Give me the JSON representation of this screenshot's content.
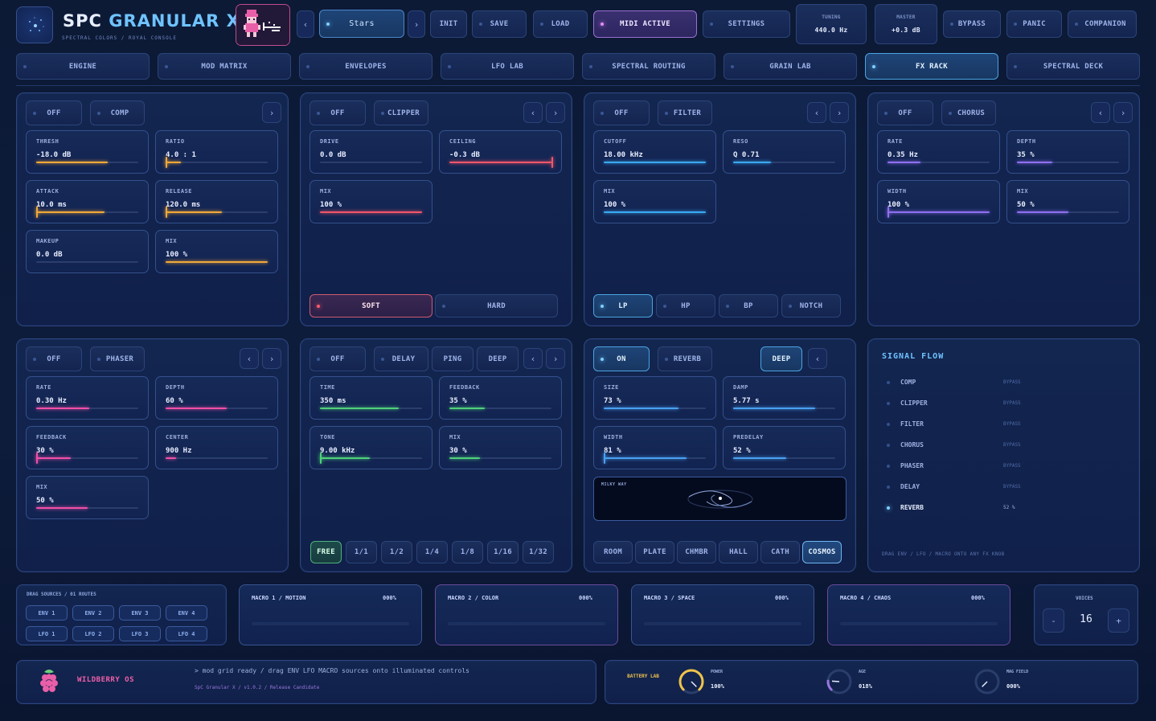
{
  "app": {
    "title_a": "SPC",
    "title_b": "GRANULAR",
    "title_c": "X",
    "subtitle": "SPECTRAL COLORS / ROYAL CONSOLE"
  },
  "topbar": {
    "preset": "Stars",
    "init": "INIT",
    "save": "SAVE",
    "load": "LOAD",
    "midi": "MIDI ACTIVE",
    "settings": "SETTINGS",
    "tuning_label": "TUNING",
    "tuning_value": "440.0 Hz",
    "master_label": "MASTER",
    "master_value": "+0.3 dB",
    "bypass": "BYPASS",
    "panic": "PANIC",
    "companion": "COMPANION"
  },
  "tabs": [
    "ENGINE",
    "MOD MATRIX",
    "ENVELOPES",
    "LFO LAB",
    "SPECTRAL ROUTING",
    "GRAIN LAB",
    "FX RACK",
    "SPECTRAL DECK"
  ],
  "active_tab": "FX RACK",
  "colors": {
    "amber": "#f0a93a",
    "red": "#f0566a",
    "blue": "#3aa9f0",
    "violet": "#8f6ff0",
    "pink": "#f04fa8",
    "green": "#4fd07a",
    "sky": "#4aa0f0"
  },
  "comp": {
    "toggle": "OFF",
    "name": "COMP",
    "params": [
      {
        "label": "THRESH",
        "value": "-18.0 dB",
        "level": 0.7
      },
      {
        "label": "RATIO",
        "value": "4.0 : 1",
        "level": 0.15
      },
      {
        "label": "ATTACK",
        "value": "10.0 ms",
        "level": 0.67
      },
      {
        "label": "RELEASE",
        "value": "120.0 ms",
        "level": 0.55
      },
      {
        "label": "MAKEUP",
        "value": "0.0 dB",
        "level": 0.0
      },
      {
        "label": "MIX",
        "value": "100 %",
        "level": 1.0
      }
    ]
  },
  "clipper": {
    "toggle": "OFF",
    "name": "CLIPPER",
    "params": [
      {
        "label": "DRIVE",
        "value": "0.0 dB",
        "level": 0.0
      },
      {
        "label": "CEILING",
        "value": "-0.3 dB",
        "level": 1.0
      },
      {
        "label": "MIX",
        "value": "100 %",
        "level": 1.0
      }
    ],
    "modes": [
      "SOFT",
      "HARD"
    ],
    "active_mode": "SOFT"
  },
  "filter": {
    "toggle": "OFF",
    "name": "FILTER",
    "params": [
      {
        "label": "CUTOFF",
        "value": "18.00 kHz",
        "level": 1.0
      },
      {
        "label": "RESO",
        "value": "Q 0.71",
        "level": 0.37
      },
      {
        "label": "MIX",
        "value": "100 %",
        "level": 1.0
      }
    ],
    "modes": [
      "LP",
      "HP",
      "BP",
      "NOTCH"
    ],
    "active_mode": "LP"
  },
  "chorus": {
    "toggle": "OFF",
    "name": "CHORUS",
    "params": [
      {
        "label": "RATE",
        "value": "0.35 Hz",
        "level": 0.32
      },
      {
        "label": "DEPTH",
        "value": "35 %",
        "level": 0.35
      },
      {
        "label": "WIDTH",
        "value": "100 %",
        "level": 1.0
      },
      {
        "label": "MIX",
        "value": "50 %",
        "level": 0.5
      }
    ]
  },
  "phaser": {
    "toggle": "OFF",
    "name": "PHASER",
    "params": [
      {
        "label": "RATE",
        "value": "0.30 Hz",
        "level": 0.52
      },
      {
        "label": "DEPTH",
        "value": "60 %",
        "level": 0.6
      },
      {
        "label": "FEEDBACK",
        "value": "30 %",
        "level": 0.34
      },
      {
        "label": "CENTER",
        "value": "900 Hz",
        "level": 0.1
      },
      {
        "label": "MIX",
        "value": "50 %",
        "level": 0.5
      }
    ]
  },
  "delay": {
    "toggle": "OFF",
    "name": "DELAY",
    "ping": "PING",
    "deep": "DEEP",
    "params": [
      {
        "label": "TIME",
        "value": "350 ms",
        "level": 0.77
      },
      {
        "label": "FEEDBACK",
        "value": "35 %",
        "level": 0.35
      },
      {
        "label": "TONE",
        "value": "9.00 kHz",
        "level": 0.49
      },
      {
        "label": "MIX",
        "value": "30 %",
        "level": 0.3
      }
    ],
    "sync": [
      "FREE",
      "1/1",
      "1/2",
      "1/4",
      "1/8",
      "1/16",
      "1/32"
    ],
    "active_sync": "FREE"
  },
  "reverb": {
    "toggle": "ON",
    "name": "REVERB",
    "deep": "DEEP",
    "params": [
      {
        "label": "SIZE",
        "value": "73 %",
        "level": 0.73
      },
      {
        "label": "DAMP",
        "value": "5.77 s",
        "level": 0.8
      },
      {
        "label": "WIDTH",
        "value": "81 %",
        "level": 0.81
      },
      {
        "label": "PREDELAY",
        "value": "52 %",
        "level": 0.52
      }
    ],
    "scope_label": "MILKY WAY",
    "modes": [
      "ROOM",
      "PLATE",
      "CHMBR",
      "HALL",
      "CATH",
      "COSMOS"
    ],
    "active_mode": "COSMOS"
  },
  "signal_flow": {
    "title": "SIGNAL FLOW",
    "rows": [
      {
        "name": "COMP",
        "state": "BYPASS",
        "active": false
      },
      {
        "name": "CLIPPER",
        "state": "BYPASS",
        "active": false
      },
      {
        "name": "FILTER",
        "state": "BYPASS",
        "active": false
      },
      {
        "name": "CHORUS",
        "state": "BYPASS",
        "active": false
      },
      {
        "name": "PHASER",
        "state": "BYPASS",
        "active": false
      },
      {
        "name": "DELAY",
        "state": "BYPASS",
        "active": false
      },
      {
        "name": "REVERB",
        "state": "52 %",
        "active": true
      }
    ],
    "hint": "DRAG ENV / LFO / MACRO ONTO ANY FX KNOB"
  },
  "sources": {
    "header": "DRAG SOURCES / 01 ROUTES",
    "chips": [
      "ENV 1",
      "ENV 2",
      "ENV 3",
      "ENV 4",
      "LFO 1",
      "LFO 2",
      "LFO 3",
      "LFO 4"
    ]
  },
  "macros": [
    {
      "label": "MACRO 1 / MOTION",
      "value": "000%"
    },
    {
      "label": "MACRO 2 / COLOR",
      "value": "000%"
    },
    {
      "label": "MACRO 3 / SPACE",
      "value": "000%"
    },
    {
      "label": "MACRO 4 / CHAOS",
      "value": "000%"
    }
  ],
  "voices": {
    "label": "VOICES",
    "value": "16",
    "minus": "-",
    "plus": "+"
  },
  "footer": {
    "os_name": "WILDBERRY OS",
    "console_line": "> mod grid ready / drag ENV LFO MACRO sources onto illuminated controls",
    "version_line": "SpC Granular X / v1.0.2 / Release Candidate",
    "battery_title": "BATTERY LAB",
    "gauges": [
      {
        "label": "POWER",
        "value": "100%"
      },
      {
        "label": "AGE",
        "value": "018%"
      },
      {
        "label": "MAG FIELD",
        "value": "000%"
      }
    ]
  }
}
